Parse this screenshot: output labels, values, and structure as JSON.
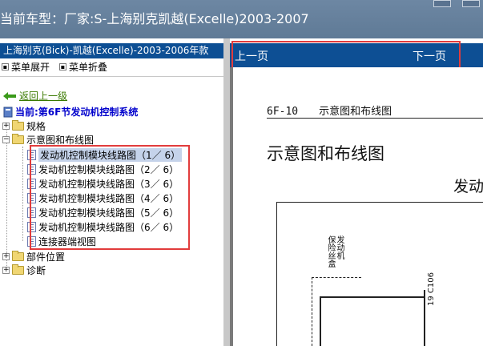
{
  "window": {
    "title": "当前车型：厂家:S-上海别克凯越(Excelle)2003-2007"
  },
  "left_panel": {
    "header": "上海别克(Bick)-凯越(Excelle)-2003-2006年款",
    "tools": {
      "expand_label": "菜单展开",
      "collapse_label": "菜单折叠"
    },
    "back_label": "返回上一级",
    "current_label": "当前:第6F节发动机控制系统",
    "tree": {
      "specs": "规格",
      "schematic": "示意图和布线图",
      "children": [
        "发动机控制模块线路图（1／ 6）",
        "发动机控制模块线路图（2／ 6）",
        "发动机控制模块线路图（3／ 6）",
        "发动机控制模块线路图（4／ 6）",
        "发动机控制模块线路图（5／ 6）",
        "发动机控制模块线路图（6／ 6）",
        "连接器端视图"
      ],
      "parts_location": "部件位置",
      "diagnosis": "诊断"
    }
  },
  "right_panel": {
    "prev_label": "上一页",
    "next_label": "下一页",
    "doc": {
      "header": "6F-10　　示意图和布线图",
      "title": "示意图和布线图",
      "subtitle": "发动",
      "fuse_label": "发动机\n保险丝盒",
      "pin_label": "19 C106"
    }
  },
  "colors": {
    "accent_blue": "#0d4f94",
    "highlight_red": "#e23c3c",
    "selection": "#c5d3ea",
    "titlebar": "#6d87a3"
  }
}
